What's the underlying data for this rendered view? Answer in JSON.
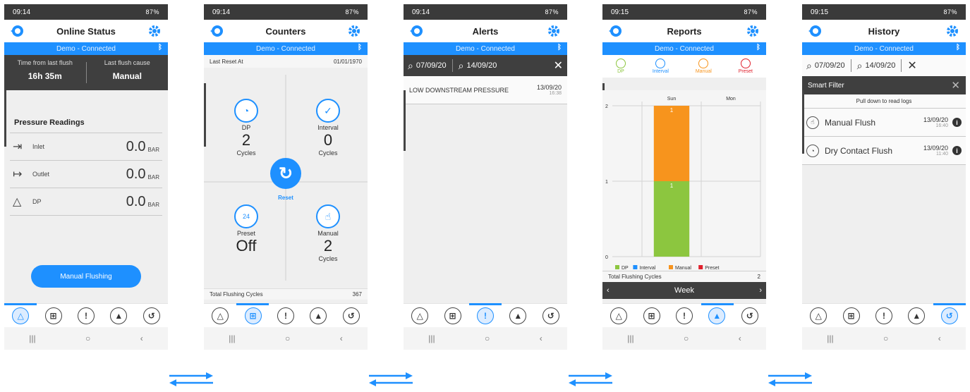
{
  "status": {
    "time1": "09:14",
    "time2": "09:15",
    "right": "87%"
  },
  "connection": "Demo - Connected",
  "bluetooth": "ᛒ",
  "screen1": {
    "title": "Online Status",
    "time_label": "Time from last flush",
    "time_value": "16h 35m",
    "cause_label": "Last flush cause",
    "cause_value": "Manual",
    "section_title": "Pressure Readings",
    "rows": [
      {
        "name": "Inlet",
        "value": "0.0",
        "unit": "BAR"
      },
      {
        "name": "Outlet",
        "value": "0.0",
        "unit": "BAR"
      },
      {
        "name": "DP",
        "value": "0.0",
        "unit": "BAR"
      }
    ],
    "button": "Manual Flushing"
  },
  "screen2": {
    "title": "Counters",
    "reset_label": "Last Reset At",
    "reset_date": "01/01/1970",
    "dp": {
      "label": "DP",
      "value": "2",
      "unit": "Cycles"
    },
    "interval": {
      "label": "Interval",
      "value": "0",
      "unit": "Cycles"
    },
    "preset": {
      "label": "Preset",
      "value": "Off"
    },
    "manual": {
      "label": "Manual",
      "value": "2",
      "unit": "Cycles"
    },
    "reset_btn": "Reset",
    "total_label": "Total Flushing Cycles",
    "total_value": "367"
  },
  "screen3": {
    "title": "Alerts",
    "from": "07/09/20",
    "to": "14/09/20",
    "alert_text": "LOW DOWNSTREAM PRESSURE",
    "alert_date": "13/09/20",
    "alert_time": "16:38"
  },
  "screen4": {
    "title": "Reports",
    "legend": {
      "dp": "DP",
      "interval": "Interval",
      "manual": "Manual",
      "preset": "Preset"
    },
    "total_label": "Total Flushing Cycles",
    "total_value": "2",
    "week": "Week",
    "chart_data": {
      "type": "bar",
      "categories": [
        "Sun",
        "Mon"
      ],
      "series": [
        {
          "name": "DP",
          "values": [
            1,
            0
          ],
          "color": "#8cc63f"
        },
        {
          "name": "Interval",
          "values": [
            0,
            0
          ],
          "color": "#1e90ff"
        },
        {
          "name": "Manual",
          "values": [
            1,
            0
          ],
          "color": "#f7941d"
        },
        {
          "name": "Preset",
          "values": [
            0,
            0
          ],
          "color": "#e0202c"
        }
      ],
      "stacked": true,
      "ylim": [
        0,
        2
      ],
      "yticks": [
        0,
        1,
        2
      ],
      "data_labels": [
        "1",
        "1"
      ]
    }
  },
  "screen5": {
    "title": "History",
    "from": "07/09/20",
    "to": "14/09/20",
    "filter": "Smart Filter",
    "pull": "Pull down to read logs",
    "logs": [
      {
        "name": "Manual Flush",
        "date": "13/09/20",
        "time": "16:40"
      },
      {
        "name": "Dry Contact Flush",
        "date": "13/09/20",
        "time": "11:40"
      }
    ]
  },
  "nav_icons": [
    "triangle-icon",
    "grid-icon",
    "alert-icon",
    "chart-icon",
    "history-icon"
  ],
  "colors": {
    "accent": "#1e90ff",
    "dark": "#3f3f3f"
  }
}
